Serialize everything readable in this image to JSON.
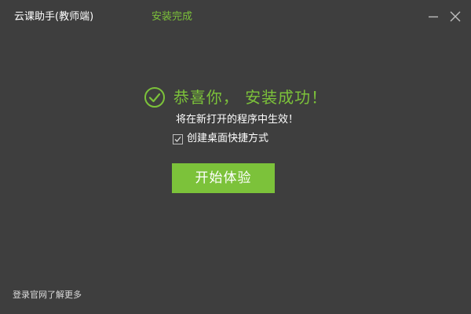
{
  "window": {
    "app_title": "云课助手(教师端)",
    "status": "安装完成",
    "minimize_icon": "minimize-icon",
    "close_icon": "close-icon"
  },
  "main": {
    "success_icon": "check-circle-icon",
    "success_title": "恭喜你， 安装成功！",
    "subtitle": "将在新打开的程序中生效！",
    "shortcut_checkbox": {
      "label": "创建桌面快捷方式",
      "checked": true
    },
    "start_button_label": "开始体验"
  },
  "footer": {
    "link_label": "登录官网了解更多"
  },
  "colors": {
    "background": "#3e3e3e",
    "accent": "#7cc23a",
    "text": "#ffffff"
  }
}
